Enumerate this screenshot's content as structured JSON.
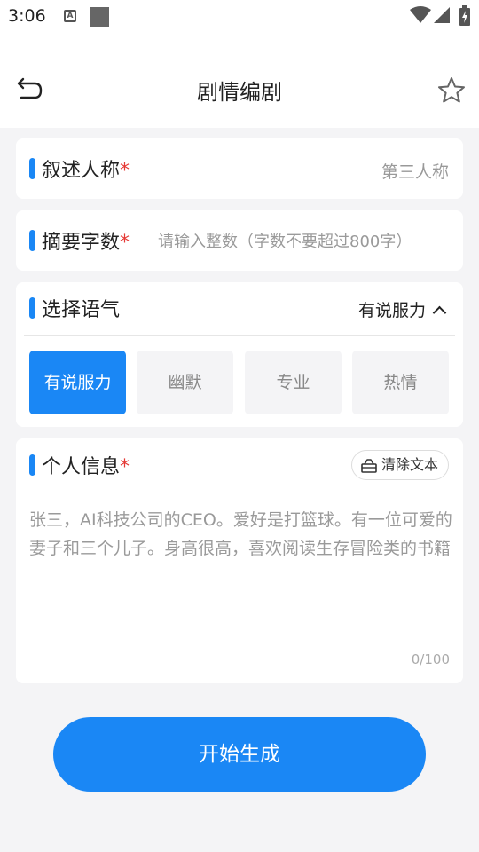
{
  "status_bar": {
    "time": "3:06",
    "notification_icon_letter": "A",
    "icons": [
      "a-notification-icon",
      "square-notification-icon",
      "wifi-icon",
      "signal-icon",
      "battery-icon"
    ]
  },
  "header": {
    "title": "剧情编剧",
    "back_icon": "back-arrow-icon",
    "favorite_icon": "star-icon"
  },
  "narrative_person": {
    "label": "叙述人称",
    "required_mark": "*",
    "value": "第三人称"
  },
  "summary_length": {
    "label": "摘要字数",
    "required_mark": "*",
    "value": "",
    "placeholder": "请输入整数（字数不要超过800字）"
  },
  "tone": {
    "label": "选择语气",
    "selected": "有说服力",
    "expanded": true,
    "options": [
      {
        "label": "有说服力",
        "active": true
      },
      {
        "label": "幽默",
        "active": false
      },
      {
        "label": "专业",
        "active": false
      },
      {
        "label": "热情",
        "active": false
      }
    ]
  },
  "personal_info": {
    "label": "个人信息",
    "required_mark": "*",
    "clear_label": "清除文本",
    "clear_icon": "eraser-icon",
    "value": "",
    "placeholder": "张三，AI科技公司的CEO。爱好是打篮球。有一位可爱的妻子和三个儿子。身高很高，喜欢阅读生存冒险类的书籍",
    "counter": "0/100"
  },
  "generate_button": {
    "label": "开始生成"
  },
  "colors": {
    "accent": "#1a87f5",
    "required": "#e53935",
    "background": "#f4f4f6"
  }
}
